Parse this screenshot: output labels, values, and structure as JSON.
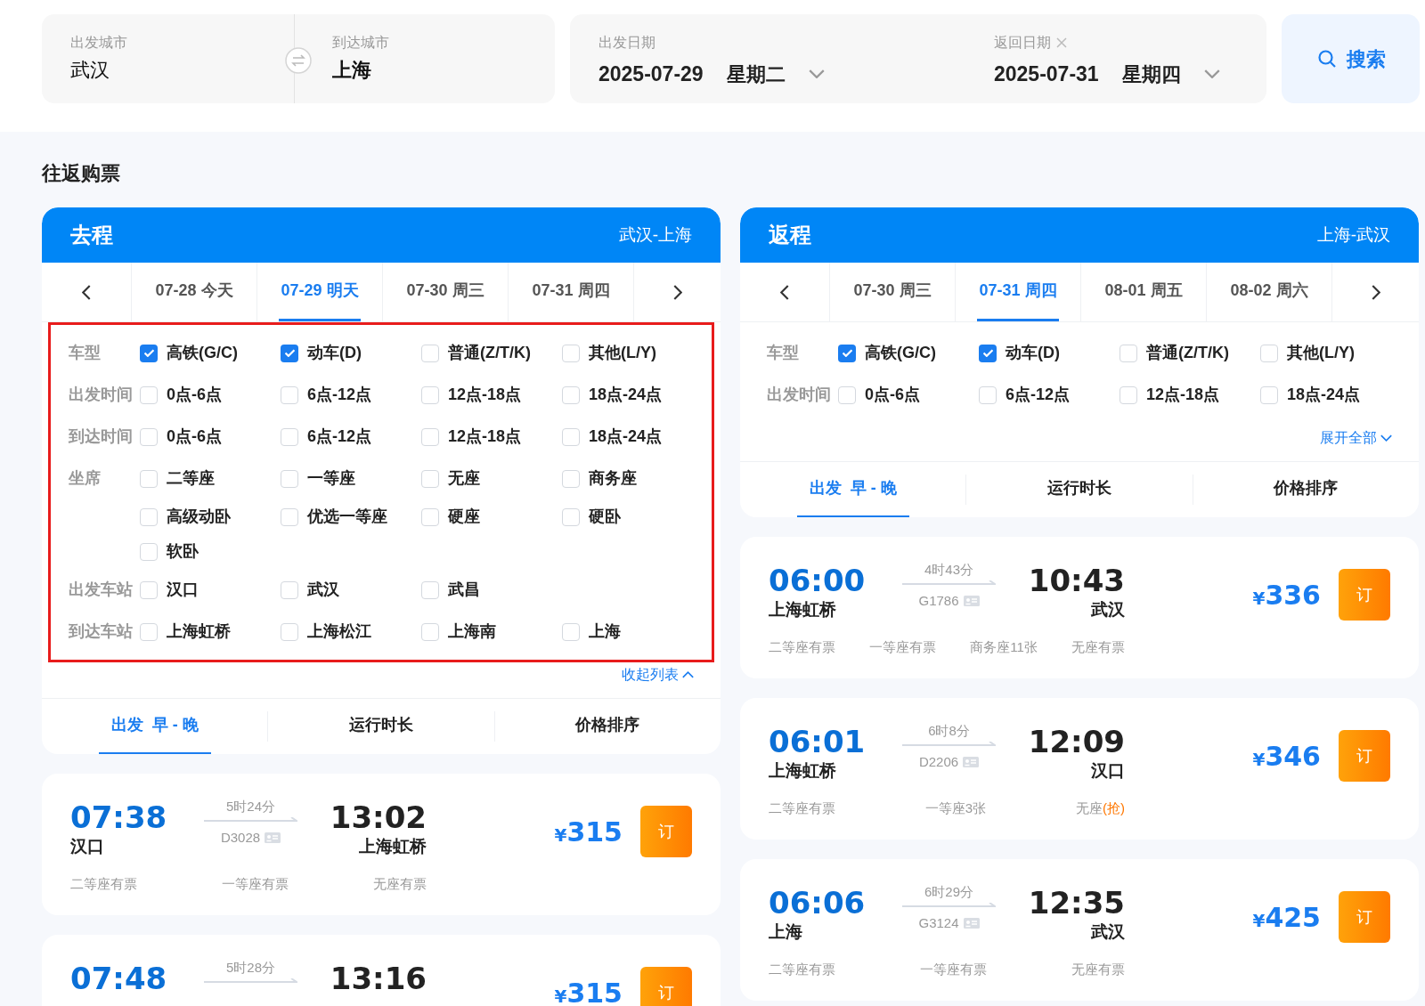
{
  "search_bar": {
    "from": {
      "label": "出发城市",
      "value": "武汉"
    },
    "to": {
      "label": "到达城市",
      "value": "上海"
    },
    "depart": {
      "label": "出发日期",
      "date": "2025-07-29",
      "weekday": "星期二"
    },
    "return": {
      "label": "返回日期",
      "date": "2025-07-31",
      "weekday": "星期四"
    },
    "search_button": "搜索"
  },
  "section_title": "往返购票",
  "legs": [
    {
      "title": "去程",
      "route": "武汉-上海",
      "highlighted": true,
      "date_tabs": [
        {
          "label": "07-28 今天",
          "selected": false
        },
        {
          "label": "07-29 明天",
          "selected": true
        },
        {
          "label": "07-30 周三",
          "selected": false
        },
        {
          "label": "07-31 周四",
          "selected": false
        }
      ],
      "filters": [
        {
          "label": "车型",
          "options": [
            {
              "label": "高铁(G/C)",
              "checked": true
            },
            {
              "label": "动车(D)",
              "checked": true
            },
            {
              "label": "普通(Z/T/K)",
              "checked": false
            },
            {
              "label": "其他(L/Y)",
              "checked": false
            }
          ]
        },
        {
          "label": "出发时间",
          "options": [
            {
              "label": "0点-6点",
              "checked": false
            },
            {
              "label": "6点-12点",
              "checked": false
            },
            {
              "label": "12点-18点",
              "checked": false
            },
            {
              "label": "18点-24点",
              "checked": false
            }
          ]
        },
        {
          "label": "到达时间",
          "options": [
            {
              "label": "0点-6点",
              "checked": false
            },
            {
              "label": "6点-12点",
              "checked": false
            },
            {
              "label": "12点-18点",
              "checked": false
            },
            {
              "label": "18点-24点",
              "checked": false
            }
          ]
        },
        {
          "label": "坐席",
          "options": [
            {
              "label": "二等座",
              "checked": false
            },
            {
              "label": "一等座",
              "checked": false
            },
            {
              "label": "无座",
              "checked": false
            },
            {
              "label": "商务座",
              "checked": false
            },
            {
              "label": "高级动卧",
              "checked": false
            },
            {
              "label": "优选一等座",
              "checked": false
            },
            {
              "label": "硬座",
              "checked": false
            },
            {
              "label": "硬卧",
              "checked": false
            },
            {
              "label": "软卧",
              "checked": false
            }
          ]
        },
        {
          "label": "出发车站",
          "options": [
            {
              "label": "汉口",
              "checked": false
            },
            {
              "label": "武汉",
              "checked": false
            },
            {
              "label": "武昌",
              "checked": false
            }
          ]
        },
        {
          "label": "到达车站",
          "options": [
            {
              "label": "上海虹桥",
              "checked": false
            },
            {
              "label": "上海松江",
              "checked": false
            },
            {
              "label": "上海南",
              "checked": false
            },
            {
              "label": "上海",
              "checked": false
            }
          ]
        }
      ],
      "toggle": {
        "label": "收起列表",
        "expanded": true
      },
      "sort_tabs": [
        {
          "label": "出发  早 - 晚",
          "selected": true
        },
        {
          "label": "运行时长",
          "selected": false
        },
        {
          "label": "价格排序",
          "selected": false
        }
      ],
      "trains": [
        {
          "depart_time": "07:38",
          "depart_station": "汉口",
          "duration": "5时24分",
          "train_no": "D3028",
          "arrive_time": "13:02",
          "arrive_station": "上海虹桥",
          "price": "315",
          "currency": "¥",
          "book": "订",
          "seats": [
            {
              "text": "二等座有票"
            },
            {
              "text": "一等座有票"
            },
            {
              "text": "无座有票"
            }
          ]
        },
        {
          "depart_time": "07:48",
          "duration": "5时28分",
          "arrive_time": "13:16",
          "currency": "¥",
          "price": "315",
          "book": "订"
        }
      ]
    },
    {
      "title": "返程",
      "route": "上海-武汉",
      "highlighted": false,
      "date_tabs": [
        {
          "label": "07-30 周三",
          "selected": false
        },
        {
          "label": "07-31 周四",
          "selected": true
        },
        {
          "label": "08-01 周五",
          "selected": false
        },
        {
          "label": "08-02 周六",
          "selected": false
        }
      ],
      "filters": [
        {
          "label": "车型",
          "options": [
            {
              "label": "高铁(G/C)",
              "checked": true
            },
            {
              "label": "动车(D)",
              "checked": true
            },
            {
              "label": "普通(Z/T/K)",
              "checked": false
            },
            {
              "label": "其他(L/Y)",
              "checked": false
            }
          ]
        },
        {
          "label": "出发时间",
          "options": [
            {
              "label": "0点-6点",
              "checked": false
            },
            {
              "label": "6点-12点",
              "checked": false
            },
            {
              "label": "12点-18点",
              "checked": false
            },
            {
              "label": "18点-24点",
              "checked": false
            }
          ]
        }
      ],
      "toggle": {
        "label": "展开全部",
        "expanded": false
      },
      "sort_tabs": [
        {
          "label": "出发  早 - 晚",
          "selected": true
        },
        {
          "label": "运行时长",
          "selected": false
        },
        {
          "label": "价格排序",
          "selected": false
        }
      ],
      "trains": [
        {
          "depart_time": "06:00",
          "depart_station": "上海虹桥",
          "duration": "4时43分",
          "train_no": "G1786",
          "arrive_time": "10:43",
          "arrive_station": "武汉",
          "currency": "¥",
          "price": "336",
          "book": "订",
          "seats": [
            {
              "text": "二等座有票"
            },
            {
              "text": "一等座有票"
            },
            {
              "text": "商务座11张"
            },
            {
              "text": "无座有票"
            }
          ]
        },
        {
          "depart_time": "06:01",
          "depart_station": "上海虹桥",
          "duration": "6时8分",
          "train_no": "D2206",
          "arrive_time": "12:09",
          "arrive_station": "汉口",
          "currency": "¥",
          "price": "346",
          "book": "订",
          "seats": [
            {
              "text": "二等座有票"
            },
            {
              "text": "一等座3张"
            },
            {
              "text": "无座",
              "extra": "(抢)"
            }
          ]
        },
        {
          "depart_time": "06:06",
          "depart_station": "上海",
          "duration": "6时29分",
          "train_no": "G3124",
          "arrive_time": "12:35",
          "arrive_station": "武汉",
          "currency": "¥",
          "price": "425",
          "book": "订",
          "seats": [
            {
              "text": "二等座有票"
            },
            {
              "text": "一等座有票"
            },
            {
              "text": "无座有票"
            }
          ]
        }
      ]
    }
  ]
}
